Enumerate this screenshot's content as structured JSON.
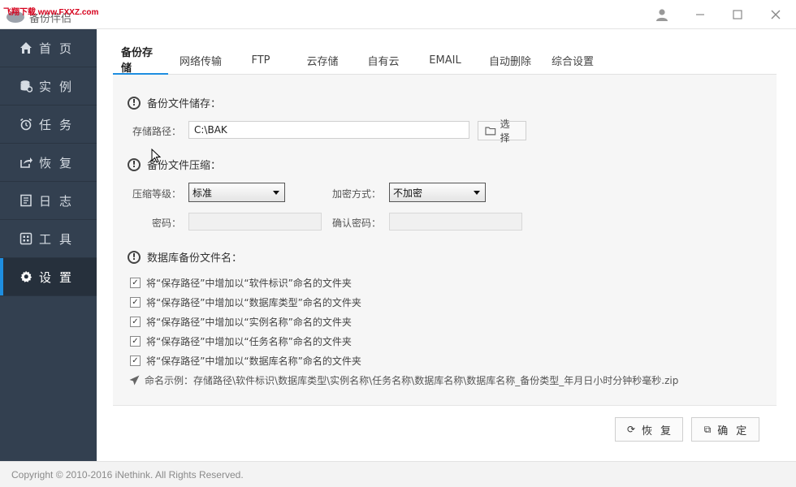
{
  "titlebar": {
    "watermark": "飞翔下载 www.FXXZ.com",
    "app_name": "备份伴侣"
  },
  "sidebar": {
    "items": [
      {
        "label": "首页",
        "icon": "home-icon"
      },
      {
        "label": "实例",
        "icon": "database-icon"
      },
      {
        "label": "任务",
        "icon": "alarm-clock-icon"
      },
      {
        "label": "恢复",
        "icon": "restore-share-icon"
      },
      {
        "label": "日志",
        "icon": "log-document-icon"
      },
      {
        "label": "工具",
        "icon": "tools-grid-icon"
      },
      {
        "label": "设置",
        "icon": "gear-icon",
        "active": true
      }
    ]
  },
  "tabs": [
    {
      "label": "备份存储",
      "active": true
    },
    {
      "label": "网络传输"
    },
    {
      "label": "FTP"
    },
    {
      "label": "云存储"
    },
    {
      "label": "自有云"
    },
    {
      "label": "EMAIL"
    },
    {
      "label": "自动删除"
    },
    {
      "label": "综合设置"
    }
  ],
  "storage": {
    "section_title": "备份文件储存：",
    "path_label": "存储路径：",
    "path_value": "C:\\BAK",
    "choose_label": "选择"
  },
  "compression": {
    "section_title": "备份文件压缩：",
    "level_label": "压缩等级：",
    "level_value": "标准",
    "encrypt_label": "加密方式：",
    "encrypt_value": "不加密",
    "password_label": "密码：",
    "confirm_password_label": "确认密码："
  },
  "naming": {
    "section_title": "数据库备份文件名：",
    "options": [
      {
        "label": "将“保存路径”中增加以“软件标识”命名的文件夹",
        "checked": true
      },
      {
        "label": "将“保存路径”中增加以“数据库类型”命名的文件夹",
        "checked": true
      },
      {
        "label": "将“保存路径”中增加以“实例名称”命名的文件夹",
        "checked": true
      },
      {
        "label": "将“保存路径”中增加以“任务名称”命名的文件夹",
        "checked": true
      },
      {
        "label": "将“保存路径”中增加以“数据库名称”命名的文件夹",
        "checked": true
      }
    ],
    "example": "命名示例：存储路径\\软件标识\\数据库类型\\实例名称\\任务名称\\数据库名称\\数据库名称_备份类型_年月日小时分钟秒毫秒.zip"
  },
  "actions": {
    "restore_label": "恢复",
    "confirm_label": "确定"
  },
  "footer": {
    "copyright": "Copyright © 2010-2016 iNethink. All Rights Reserved."
  },
  "colors": {
    "sidebar_bg": "#334050",
    "accent": "#1e8ee0"
  }
}
